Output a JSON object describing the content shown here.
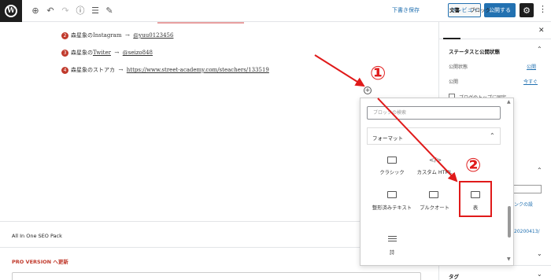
{
  "toolbar": {
    "save_draft": "下書き保存",
    "preview": "プレビュー",
    "publish": "公開する",
    "settings_icon": "gear-icon",
    "more_icon": "more-vertical-icon"
  },
  "content": {
    "lines": [
      {
        "num": "2",
        "name": "森星象の",
        "service": "Instagram",
        "arrow": "→",
        "value": "@yuu0123456"
      },
      {
        "num": "3",
        "name": "森星象の",
        "service": "Twiter",
        "arrow": "→",
        "value": "@seizo848"
      },
      {
        "num": "4",
        "name": "森星象のストアカ",
        "service": "",
        "arrow": "→",
        "value": "https://www.street-academy.com/steachers/133519"
      }
    ]
  },
  "inserter": {
    "search_placeholder": "ブロックの検索",
    "group_label": "フォーマット",
    "blocks": [
      {
        "label": "クラシック",
        "icon": "keyboard-icon"
      },
      {
        "label": "カスタム HTML",
        "icon": "html-icon"
      },
      {
        "label": "表",
        "icon": "table-icon"
      },
      {
        "label": "整形済みテキスト",
        "icon": "preformatted-icon"
      },
      {
        "label": "プルクオート",
        "icon": "pullquote-icon"
      },
      {
        "label": "詩",
        "icon": "verse-icon"
      }
    ]
  },
  "sidebar": {
    "tab_document": "文書",
    "tab_block": "ブロック",
    "section_status": "ステータスと公開状態",
    "visibility_label": "公開状態",
    "visibility_value": "公開",
    "publish_label": "公開",
    "publish_value": "今すぐ",
    "sticky_label": "ブログのトップに固定",
    "permalink_link": "ンクの設",
    "permalink_date": "20200413/",
    "tag_label": "タグ"
  },
  "seo": {
    "title": "All In One SEO Pack",
    "pro": "PRO VERSION へ更新"
  },
  "annotations": {
    "step1": "①",
    "step2": "②"
  },
  "colors": {
    "accent": "#2271b1",
    "annotation": "#e01a1a"
  }
}
